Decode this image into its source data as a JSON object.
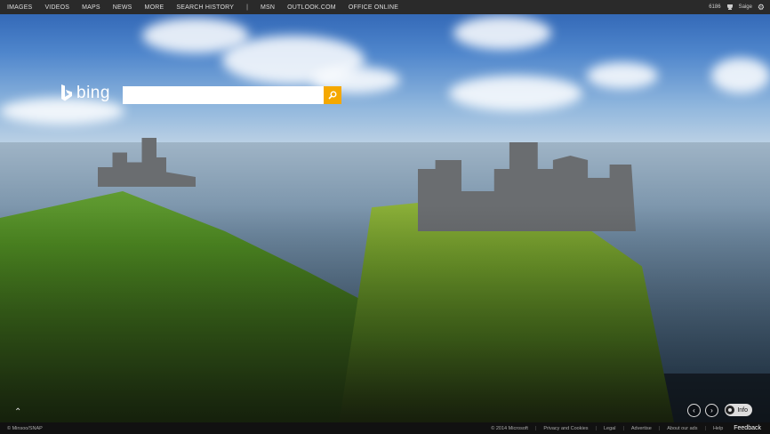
{
  "nav": {
    "items": [
      {
        "label": "IMAGES"
      },
      {
        "label": "VIDEOS"
      },
      {
        "label": "MAPS"
      },
      {
        "label": "NEWS"
      },
      {
        "label": "MORE"
      },
      {
        "label": "SEARCH HISTORY"
      }
    ],
    "separator": "|",
    "extra_items": [
      {
        "label": "MSN"
      },
      {
        "label": "OUTLOOK.COM"
      },
      {
        "label": "OFFICE ONLINE"
      }
    ]
  },
  "top_right": {
    "rewards_count": "6186",
    "trophy_icon": "trophy-icon",
    "user_label": "Saige",
    "settings_icon": "gear-icon"
  },
  "logo": {
    "text": "bing",
    "mark_icon": "bing-logo-mark"
  },
  "search": {
    "value": "",
    "placeholder": "",
    "button_icon": "search-icon",
    "button_color": "#f5a800"
  },
  "controls": {
    "scroll_up_icon": "chevron-up-icon",
    "prev_icon": "chevron-left-icon",
    "next_icon": "chevron-right-icon",
    "info_label": "Info"
  },
  "footer": {
    "image_credit": "© Minsoo/SNAP",
    "copyright": "© 2014 Microsoft",
    "links": [
      {
        "label": "Privacy and Cookies"
      },
      {
        "label": "Legal"
      },
      {
        "label": "Advertise"
      },
      {
        "label": "About our ads"
      },
      {
        "label": "Help"
      }
    ],
    "feedback": "Feedback"
  }
}
